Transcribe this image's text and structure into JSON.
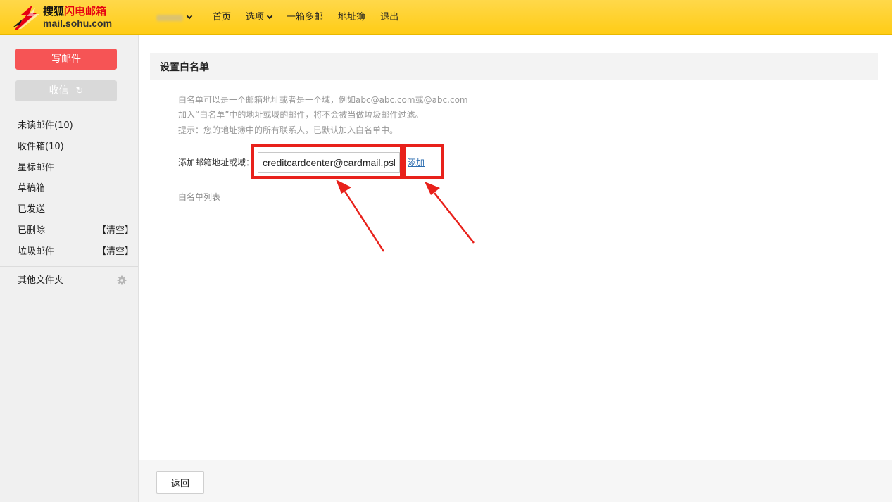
{
  "header": {
    "logo_title_a": "搜狐",
    "logo_title_b": "闪电邮箱",
    "logo_sub": "mail.sohu.com",
    "nav": [
      {
        "label": "首页"
      },
      {
        "label": "选项"
      },
      {
        "label": "一箱多邮"
      },
      {
        "label": "地址簿"
      },
      {
        "label": "退出"
      }
    ],
    "colors": {
      "bar": "#ffcc15",
      "brand_red": "#e60012"
    }
  },
  "sidebar": {
    "compose_label": "写邮件",
    "receive_label": "收信",
    "folders": [
      {
        "label": "未读邮件(10)"
      },
      {
        "label": "收件箱(10)"
      },
      {
        "label": "星标邮件"
      },
      {
        "label": "草稿箱"
      },
      {
        "label": "已发送"
      },
      {
        "label": "已删除",
        "clear": "【清空】"
      },
      {
        "label": "垃圾邮件",
        "clear": "【清空】"
      }
    ],
    "other_folders": "其他文件夹",
    "colors": {
      "compose": "#f65455",
      "receive": "#d9d9d9"
    }
  },
  "main": {
    "title": "设置白名单",
    "hints": [
      "白名单可以是一个邮箱地址或者是一个域，例如abc@abc.com或@abc.com",
      "加入“白名单”中的地址或域的邮件，将不会被当做垃圾邮件过滤。",
      "提示：您的地址簿中的所有联系人，已默认加入白名单中。"
    ],
    "add_label": "添加邮箱地址或域：",
    "email_value": "creditcardcenter@cardmail.psbc.com",
    "add_link": "添加",
    "list_title": "白名单列表",
    "highlight_color": "#e8211b"
  },
  "footer": {
    "back_label": "返回"
  }
}
